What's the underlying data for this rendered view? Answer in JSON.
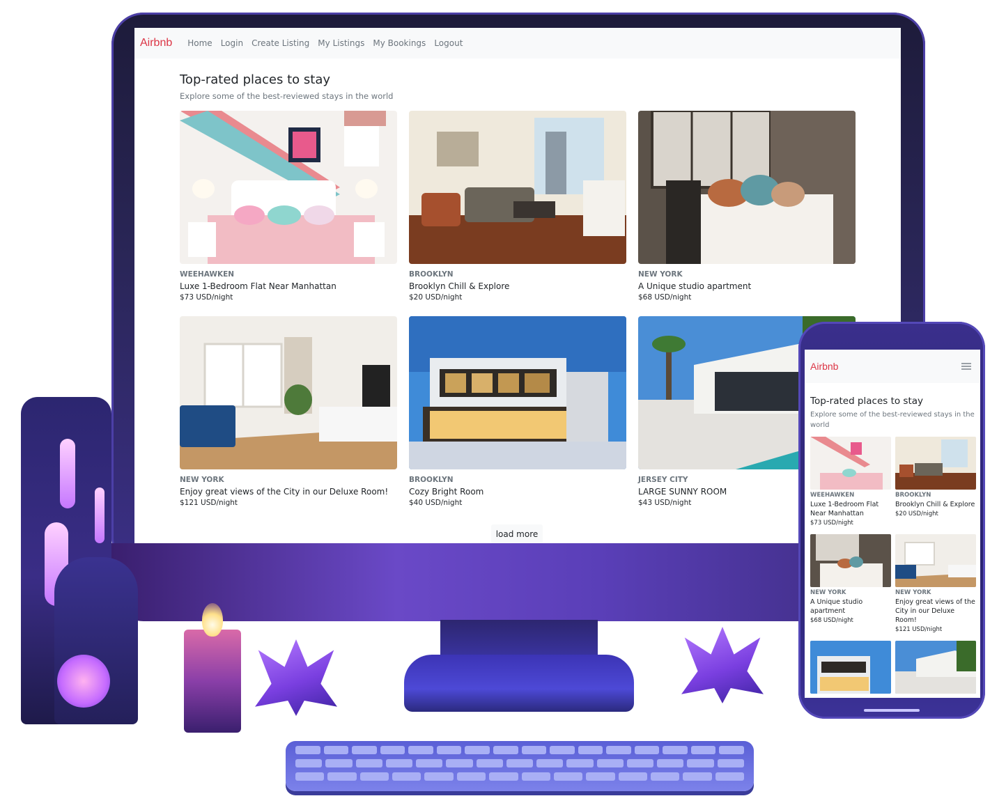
{
  "desktop": {
    "nav": {
      "brand": "Airbnb",
      "links": [
        "Home",
        "Login",
        "Create Listing",
        "My Listings",
        "My Bookings",
        "Logout"
      ]
    },
    "header": {
      "title": "Top-rated places to stay",
      "subtitle": "Explore some of the best-reviewed stays in the world"
    },
    "listings": [
      {
        "city": "WEEHAWKEN",
        "title": "Luxe 1-Bedroom Flat Near Manhattan",
        "price": "$73 USD/night"
      },
      {
        "city": "BROOKLYN",
        "title": "Brooklyn Chill & Explore",
        "price": "$20 USD/night"
      },
      {
        "city": "NEW YORK",
        "title": "A Unique studio apartment",
        "price": "$68 USD/night"
      },
      {
        "city": "NEW YORK",
        "title": "Enjoy great views of the City in our Deluxe Room!",
        "price": "$121 USD/night"
      },
      {
        "city": "BROOKLYN",
        "title": "Cozy Bright Room",
        "price": "$40 USD/night"
      },
      {
        "city": "JERSEY CITY",
        "title": "LARGE SUNNY ROOM",
        "price": "$43 USD/night"
      }
    ],
    "load_more_label": "load more"
  },
  "mobile": {
    "nav": {
      "brand": "Airbnb",
      "menu_icon": "hamburger-menu-icon"
    },
    "header": {
      "title": "Top-rated places to stay",
      "subtitle": "Explore some of the best-reviewed stays in the world"
    },
    "listings": [
      {
        "city": "WEEHAWKEN",
        "title": "Luxe 1-Bedroom Flat Near Manhattan",
        "price": "$73 USD/night"
      },
      {
        "city": "BROOKLYN",
        "title": "Brooklyn Chill & Explore",
        "price": "$20 USD/night"
      },
      {
        "city": "NEW YORK",
        "title": "A Unique studio apartment",
        "price": "$68 USD/night"
      },
      {
        "city": "NEW YORK",
        "title": "Enjoy great views of the City in our Deluxe Room!",
        "price": "$121 USD/night"
      }
    ]
  },
  "colors": {
    "brand": "#dc3545",
    "nav_bg": "#f8f9fa",
    "muted_text": "#6c757d",
    "body_text": "#212529",
    "device_purple": "#3b2f86"
  }
}
